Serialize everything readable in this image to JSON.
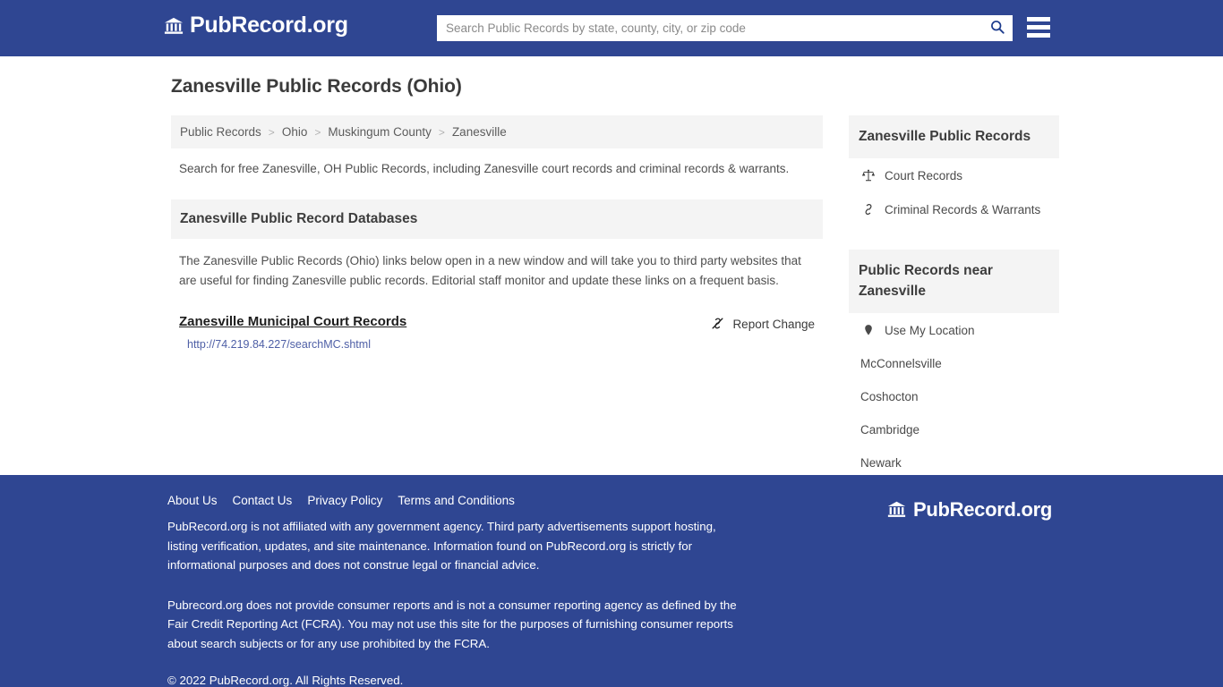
{
  "header": {
    "brand_name": "PubRecord.org",
    "brand_icon": "bank-building-icon",
    "search_placeholder": "Search Public Records by state, county, city, or zip code",
    "search_value": "",
    "search_icon": "search-icon",
    "menu_icon": "hamburger-menu-icon"
  },
  "main": {
    "page_title": "Zanesville Public Records (Ohio)",
    "breadcrumb": [
      {
        "label": "Public Records"
      },
      {
        "label": "Ohio"
      },
      {
        "label": "Muskingum County"
      },
      {
        "label": "Zanesville"
      }
    ],
    "breadcrumb_separator": ">",
    "intro": "Search for free Zanesville, OH Public Records, including Zanesville court records and criminal records & warrants.",
    "section_title": "Zanesville Public Record Databases",
    "section_body": "The Zanesville Public Records (Ohio) links below open in a new window and will take you to third party websites that are useful for finding Zanesville public records. Editorial staff monitor and update these links on a frequent basis.",
    "records": [
      {
        "title": "Zanesville Municipal Court Records",
        "url": "http://74.219.84.227/searchMC.shtml",
        "report_label": "Report Change",
        "report_icon": "broken-link-icon"
      }
    ]
  },
  "sidebar": {
    "card1": {
      "title": "Zanesville Public Records",
      "items": [
        {
          "label": "Court Records",
          "icon": "balance-scale-icon"
        },
        {
          "label": "Criminal Records & Warrants",
          "icon": "link-chain-icon"
        }
      ]
    },
    "card2": {
      "title": "Public Records near Zanesville",
      "items": [
        {
          "label": "Use My Location",
          "icon": "map-pin-icon"
        },
        {
          "label": "McConnelsville",
          "icon": ""
        },
        {
          "label": "Coshocton",
          "icon": ""
        },
        {
          "label": "Cambridge",
          "icon": ""
        },
        {
          "label": "Newark",
          "icon": ""
        }
      ]
    }
  },
  "footer": {
    "nav": [
      {
        "label": "About Us"
      },
      {
        "label": "Contact Us"
      },
      {
        "label": "Privacy Policy"
      },
      {
        "label": "Terms and Conditions"
      }
    ],
    "disclaimer1": "PubRecord.org is not affiliated with any government agency. Third party advertisements support hosting, listing verification, updates, and site maintenance. Information found on PubRecord.org is strictly for informational purposes and does not construe legal or financial advice.",
    "disclaimer2": "Pubrecord.org does not provide consumer reports and is not a consumer reporting agency as defined by the Fair Credit Reporting Act (FCRA). You may not use this site for the purposes of furnishing consumer reports about search subjects or for any use prohibited by the FCRA.",
    "copyright": "© 2022 PubRecord.org. All Rights Reserved.",
    "brand_name": "PubRecord.org",
    "brand_icon": "bank-building-icon"
  },
  "colors": {
    "brand_blue": "#2f4692",
    "band_gray": "#f4f4f4",
    "link_blue": "#4e5fa6",
    "body_text": "#4f4f4f"
  }
}
